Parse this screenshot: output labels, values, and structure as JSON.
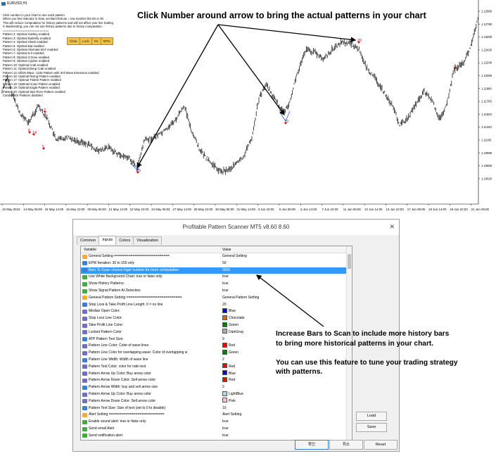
{
  "chart": {
    "symbol": "EURUSD,H1",
    "info_lines": [
      "Click number in your chart to see each pattern",
      "When you feel indicator is slow, set BarsToScan = low number like 50 or 30",
      "This will reduce computation for history patterns and will not affect your live trading.",
      "In Backtesting, you can not use history patterns due to heavy computation.",
      "==========================",
      "Pattern 2: Optimal Gartley enabled",
      "Pattern 3: Optimal Butterfly enabled",
      "Pattern 4: Optimal Shark enabled",
      "Pattern 5: Optimal Bat enabled",
      "Pattern 6: Optimal Alternate BAT enabled",
      "Pattern 7: Optimal 5-0 enabled",
      "Pattern 8: Optimal 3 Drive enabled",
      "Pattern 9: Optimal Cypher enabled",
      "Pattern 10: Optimal Crab enabled",
      "Pattern 11: Optimal Deep Crab enabled",
      "Pattern 12: Elliott Wave .1234 Pattern with 3rd Wave Extension enabled",
      "Pattern 16: Optimal Rising Pattern enabled",
      "Pattern 17: Optimal Trident Pattern enabled",
      "Pattern 18: Optimal Horse Pattern enabled",
      "Pattern 19: Optimal Eagle Pattern enabled",
      "Pattern 20: Optimal Star River Pattern enabled"
    ],
    "candlestick_label": "Candlestick Patterns disabled",
    "buttons": [
      "Clear",
      "Lock",
      "H1",
      "MTD"
    ],
    "y_ticks": [
      "1.12960",
      "1.12780",
      "1.12600",
      "1.12420",
      "1.12240",
      "1.12060",
      "1.11880",
      "1.11700",
      "1.11520",
      "1.11340",
      "1.11160",
      "1.10980",
      "1.10800",
      "1.10620"
    ],
    "x_ticks": [
      "10 May 2019",
      "14 May 06:00",
      "15 May 14:00",
      "16 May 22:00",
      "20 May 06:00",
      "21 May 14:00",
      "22 May 22:00",
      "24 May 06:00",
      "27 May 14:00",
      "28 May 22:00",
      "30 May 06:00",
      "31 May 14:00",
      "3 Jun 22:00",
      "5 Jun 06:00",
      "6 Jun 14:00",
      "7 Jun 22:00",
      "11 Jun 06:00",
      "12 Jun 14:00",
      "13 Jun 22:00",
      "17 Jun 06:00",
      "18 Jun 14:00",
      "19 Jun 22:00",
      "21 Jun 06:00"
    ],
    "markers": [
      "6",
      "2",
      "14",
      "5",
      "15",
      "10",
      "4",
      "20"
    ],
    "colors": {
      "candle": "#333333",
      "marker": "#dd0000",
      "arrow": "#000000",
      "pattern_line": "#2255cc"
    }
  },
  "annotations": {
    "top": "Click Number around arrow to bring the actual patterns in your chart",
    "middle": [
      "Increase Bars to Scan to include more history bars",
      "to bring more historical patterns in your chart.",
      "",
      "You can use this feature to tune your trading strategy",
      "with patterns."
    ]
  },
  "dialog": {
    "title": "Profitable Pattern Scanner MT5 v8.60 8.60",
    "close": "✕",
    "tabs": [
      "Common",
      "Inputs",
      "Colors",
      "Visualization"
    ],
    "active_tab": "Inputs",
    "headers": {
      "variable": "Variable",
      "value": "Value"
    },
    "rows": [
      {
        "icon": "set",
        "var": "General Setting ===========================",
        "val": "General Setting"
      },
      {
        "icon": "num",
        "var": "EPW Iteration: 30 to 150 only",
        "val": "50"
      },
      {
        "icon": "num",
        "var": "Bars To Scan: choose higer number for more computation",
        "val": "3000",
        "selected": true
      },
      {
        "icon": "bool",
        "var": "Use White Background Chart: true or false only",
        "val": "true"
      },
      {
        "icon": "bool",
        "var": "Show History Patterns:",
        "val": "true"
      },
      {
        "icon": "bool",
        "var": "Show Signal Pattern At Detection",
        "val": "true"
      },
      {
        "icon": "set",
        "var": "General Pattern Setting ===========================",
        "val": "General Pattern Setting"
      },
      {
        "icon": "num",
        "var": "Stop Loss & Take Profit Line Length: 0 = no line",
        "val": "20"
      },
      {
        "icon": "col",
        "var": "Median Open Color:",
        "val": "Blue",
        "swatch": "#0000ff"
      },
      {
        "icon": "col",
        "var": "Stop Loss Line Color:",
        "val": "Chocolate",
        "swatch": "#d2691e"
      },
      {
        "icon": "col",
        "var": "Take Profit Line Color:",
        "val": "Green",
        "swatch": "#008000"
      },
      {
        "icon": "col",
        "var": "Locked Pattern Color",
        "val": "DarkGray",
        "swatch": "#a9a9a9"
      },
      {
        "icon": "num",
        "var": "ATP Pattern Text Size:",
        "val": "9"
      },
      {
        "icon": "col",
        "var": "Pattern Line Color: Color of wave lines",
        "val": "Red",
        "swatch": "#ff0000"
      },
      {
        "icon": "col",
        "var": "Pattern Line Color for overlapping wave: Color of overlapping w",
        "val": "Green",
        "swatch": "#008000"
      },
      {
        "icon": "num",
        "var": "Pattern Line Width: Width of wave line",
        "val": "2"
      },
      {
        "icon": "col",
        "var": "Pattern Text Color: color for ratio text",
        "val": "Red",
        "swatch": "#ff0000"
      },
      {
        "icon": "col",
        "var": "Pattern Arrow Up Color: Buy arrow color",
        "val": "Blue",
        "swatch": "#0000ff"
      },
      {
        "icon": "col",
        "var": "Pattern Arrow Down Color: Sell arrow color",
        "val": "Red",
        "swatch": "#ff0000"
      },
      {
        "icon": "num",
        "var": "Pattern Arrow Width: buy and sell arrow size",
        "val": "2"
      },
      {
        "icon": "col",
        "var": "Pattern Arrow Up Color: Buy arrow color",
        "val": "LightBlue",
        "swatch": "#add8e6"
      },
      {
        "icon": "col",
        "var": "Pattern Arrow Down Color: Sell arrow color",
        "val": "Pink",
        "swatch": "#ffc0cb"
      },
      {
        "icon": "num",
        "var": "Pattern Text Size: Size of text (set to 0 to disable)",
        "val": "10"
      },
      {
        "icon": "set",
        "var": "Alert Setting ===========================",
        "val": "Alert Setting"
      },
      {
        "icon": "bool",
        "var": "Enable sound alert: true or false only",
        "val": "true"
      },
      {
        "icon": "bool",
        "var": "Send email Alert",
        "val": "true"
      },
      {
        "icon": "bool",
        "var": "Send notification alert",
        "val": "true"
      }
    ],
    "side_buttons": {
      "load": "Load",
      "save": "Save"
    },
    "footer_buttons": {
      "ok": "확인",
      "cancel": "취소",
      "reset": "Reset"
    }
  }
}
